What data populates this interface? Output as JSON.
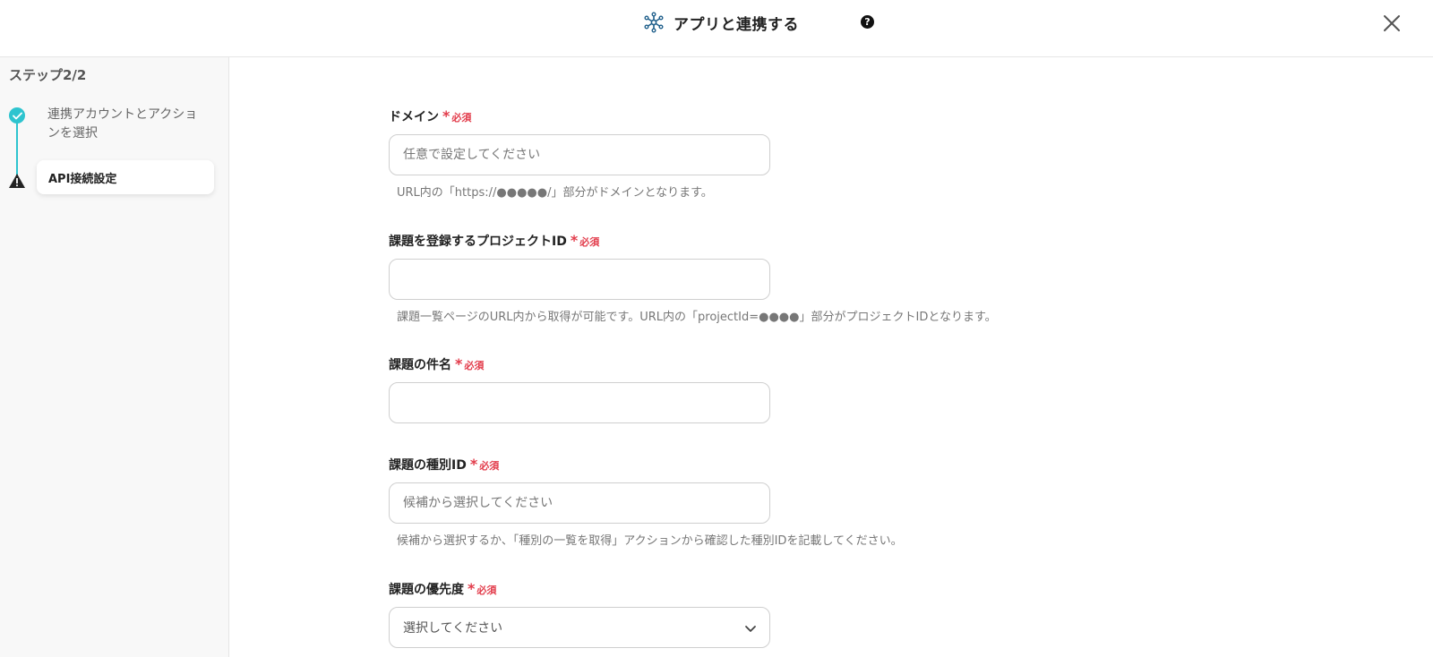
{
  "header": {
    "title": "アプリと連携する",
    "help_glyph": "?"
  },
  "sidebar": {
    "step_label": "ステップ2/2",
    "steps": [
      {
        "label": "連携アカウントとアクションを選択",
        "status": "done"
      },
      {
        "label": "API接続設定",
        "status": "warning"
      }
    ]
  },
  "form": {
    "required_text": "必須",
    "required_mark": "*",
    "fields": [
      {
        "label": "ドメイン",
        "placeholder": "任意で設定してください",
        "hint": "URL内の「https://●●●●●/」部分がドメインとなります。"
      },
      {
        "label": "課題を登録するプロジェクトID",
        "placeholder": "",
        "hint": "課題一覧ページのURL内から取得が可能です。URL内の「projectId=●●●●」部分がプロジェクトIDとなります。"
      },
      {
        "label": "課題の件名",
        "placeholder": ""
      },
      {
        "label": "課題の種別ID",
        "placeholder": "候補から選択してください",
        "hint": "候補から選択するか、「種別の一覧を取得」アクションから確認した種別IDを記載してください。"
      },
      {
        "label": "課題の優先度",
        "selected": "選択してください"
      }
    ]
  },
  "colors": {
    "accent": "#2ec4cf",
    "required": "#e23b4a"
  }
}
